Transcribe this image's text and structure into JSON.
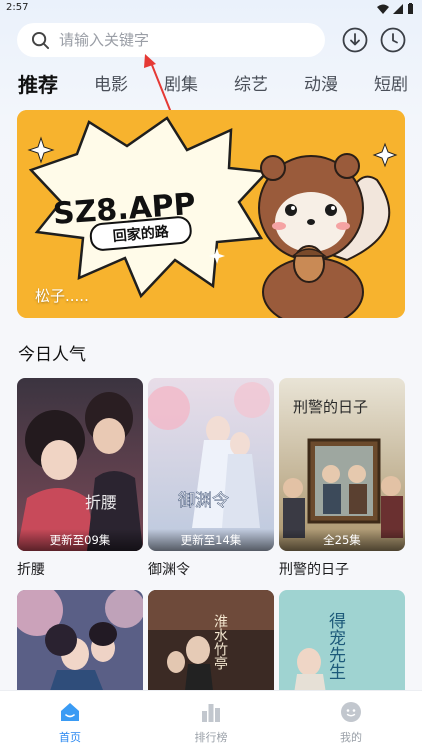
{
  "status_bar": {
    "time": "2:57"
  },
  "search": {
    "placeholder": "请输入关键字"
  },
  "header_icons": [
    "download-icon",
    "history-clock-icon"
  ],
  "tabs": [
    {
      "label": "推荐",
      "active": true
    },
    {
      "label": "电影",
      "active": false
    },
    {
      "label": "剧集",
      "active": false
    },
    {
      "label": "综艺",
      "active": false
    },
    {
      "label": "动漫",
      "active": false
    },
    {
      "label": "短剧",
      "active": false
    }
  ],
  "banner": {
    "headline": "SZ8.APP",
    "ribbon": "回家的路",
    "caption": "松子....."
  },
  "section": {
    "title": "今日人气"
  },
  "cards": [
    {
      "title": "折腰",
      "badge": "更新至09集",
      "poster_text": "折腰"
    },
    {
      "title": "御渊令",
      "badge": "更新至14集",
      "poster_text": "御渊令"
    },
    {
      "title": "刑警的日子",
      "badge": "全25集",
      "poster_text": "刑警的日子"
    }
  ],
  "cards_row2": [
    {
      "poster_text": ""
    },
    {
      "poster_text": "淮水竹亭"
    },
    {
      "poster_text": "得宠先生"
    }
  ],
  "bottom_nav": [
    {
      "label": "首页",
      "icon": "home-icon",
      "active": true
    },
    {
      "label": "排行榜",
      "icon": "ranking-icon",
      "active": false
    },
    {
      "label": "我的",
      "icon": "profile-icon",
      "active": false
    }
  ],
  "colors": {
    "accent": "#2b88f0",
    "banner_bg": "#f7b32e"
  }
}
